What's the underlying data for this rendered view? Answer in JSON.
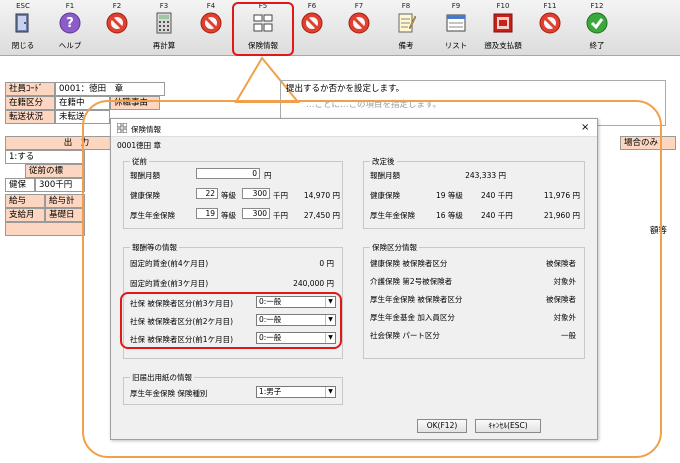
{
  "toolbar": {
    "keys": [
      {
        "key": "ESC",
        "label": "閉じる",
        "icon": "door-icon"
      },
      {
        "key": "F1",
        "label": "ヘルプ",
        "icon": "help-icon"
      },
      {
        "key": "F2",
        "label": "",
        "icon": "prohibited-icon"
      },
      {
        "key": "F3",
        "label": "再計算",
        "icon": "calculator-icon"
      },
      {
        "key": "F4",
        "label": "",
        "icon": "prohibited-icon"
      },
      {
        "key": "F5",
        "label": "保険情報",
        "icon": "insurance-info-icon"
      },
      {
        "key": "F6",
        "label": "",
        "icon": "prohibited-icon"
      },
      {
        "key": "F7",
        "label": "",
        "icon": "prohibited-icon"
      },
      {
        "key": "F8",
        "label": "備考",
        "icon": "memo-icon"
      },
      {
        "key": "F9",
        "label": "リスト",
        "icon": "list-icon"
      },
      {
        "key": "F10",
        "label": "遡及支払額",
        "icon": "retro-pay-icon"
      },
      {
        "key": "F11",
        "label": "",
        "icon": "prohibited-icon"
      },
      {
        "key": "F12",
        "label": "終了",
        "icon": "check-icon"
      }
    ]
  },
  "background": {
    "employee_code_label": "社員ｺｰﾄﾞ",
    "employee_code_value": "0001：徳田　章",
    "status_label": "在籍区分",
    "status_value": "在籍中",
    "leave_label": "休職事由",
    "transfer_label": "転送状況",
    "transfer_value": "未転送",
    "notice_line1": "提出するか否かを設定します。",
    "notice_line2": "…ごとに…この項目を指定します。",
    "output_header": "出　力",
    "output_value": "1:する",
    "prev_label": "従前の標",
    "health_label": "健保",
    "health_value": "300千円",
    "pay_label": "給与",
    "paycalc_label": "給与計",
    "paymonth_label": "支給月",
    "base_label": "基礎日",
    "right_header": "場合のみ",
    "right_text": "額等"
  },
  "dialog": {
    "title": "保険情報",
    "close": "×",
    "employee": "0001徳田 章",
    "before": {
      "title": "従前",
      "salary_label": "報酬月額",
      "salary_value": "0",
      "salary_unit": "円",
      "health_label": "健康保険",
      "health_grade": "22",
      "grade_unit": "等級",
      "health_amount": "300",
      "amount_unit": "千円",
      "health_yen": "14,970 円",
      "pension_label": "厚生年金保険",
      "pension_grade": "19",
      "pension_amount": "300",
      "pension_yen": "27,450 円"
    },
    "after": {
      "title": "改定後",
      "salary_label": "報酬月額",
      "salary_value": "243,333 円",
      "health_label": "健康保険",
      "health_grade": "19 等級",
      "health_amount": "240 千円",
      "health_yen": "11,976 円",
      "pension_label": "厚生年金保険",
      "pension_grade": "16 等級",
      "pension_amount": "240 千円",
      "pension_yen": "21,960 円"
    },
    "salary_info": {
      "title": "報酬等の情報",
      "fixed4_label": "固定的賃金(前4ケ月目)",
      "fixed4_value": "0 円",
      "fixed3_label": "固定的賃金(前3ケ月目)",
      "fixed3_value": "240,000 円",
      "cat3_label": "社保 被保険者区分(前3ケ月目)",
      "cat3_value": "0:一般",
      "cat2_label": "社保 被保険者区分(前2ケ月目)",
      "cat2_value": "0:一般",
      "cat1_label": "社保 被保険者区分(前1ケ月目)",
      "cat1_value": "0:一般"
    },
    "insurance_category": {
      "title": "保険区分情報",
      "rows": [
        {
          "label": "健康保険 被保険者区分",
          "value": "被保険者"
        },
        {
          "label": "介護保険 第2号被保険者",
          "value": "対象外"
        },
        {
          "label": "厚生年金保険 被保険者区分",
          "value": "被保険者"
        },
        {
          "label": "厚生年金基金 加入員区分",
          "value": "対象外"
        },
        {
          "label": "社会保険 パート区分",
          "value": "一般"
        }
      ]
    },
    "old_form": {
      "title": "旧届出用紙の情報",
      "type_label": "厚生年金保険 保険種別",
      "type_value": "1:男子"
    },
    "ok_label": "OK(F12)",
    "cancel_label": "ｷｬﾝｾﾙ(ESC)"
  },
  "colors": {
    "highlight": "#e01818",
    "callout": "#f0a04a",
    "header_bg": "#fcd6c0"
  }
}
